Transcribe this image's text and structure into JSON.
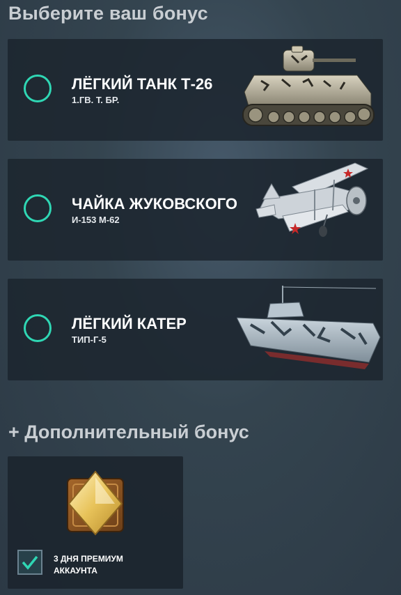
{
  "page": {
    "title": "Выберите ваш бонус"
  },
  "bonuses": [
    {
      "title": "ЛЁГКИЙ ТАНК Т-26",
      "subtitle": "1.ГВ. Т. БР.",
      "icon": "tank-image"
    },
    {
      "title": "ЧАЙКА ЖУКОВСКОГО",
      "subtitle": "И-153 М-62",
      "icon": "biplane-image"
    },
    {
      "title": "ЛЁГКИЙ КАТЕР",
      "subtitle": "ТИП-Г-5",
      "icon": "boat-image"
    }
  ],
  "extra": {
    "title": "+ Дополнительный бонус",
    "label_line1": "3 ДНЯ ПРЕМИУМ",
    "label_line2": "АККАУНТА",
    "checked": true,
    "icon": "premium-diamond-icon"
  },
  "colors": {
    "accent": "#2fd7b4",
    "card_bg": "#1c252e",
    "heading": "#c9ced3",
    "gold": "#e8c35a"
  }
}
